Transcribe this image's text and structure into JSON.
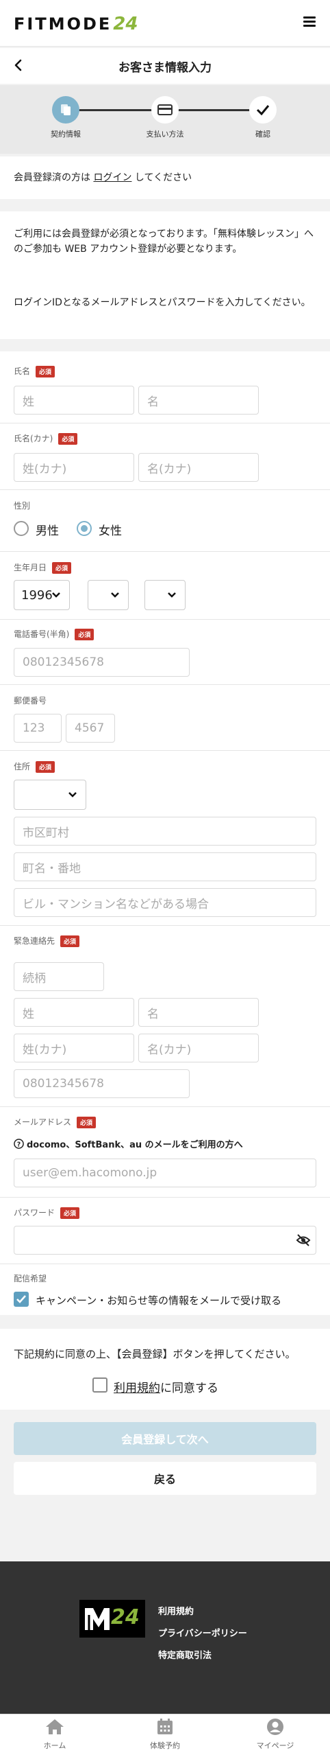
{
  "header": {
    "logo_text": "FITMODE",
    "logo_num": "24",
    "title": "お客さま情報入力"
  },
  "steps": [
    {
      "label": "契約情報",
      "icon": "document-icon",
      "active": true
    },
    {
      "label": "支払い方法",
      "icon": "card-icon",
      "active": false
    },
    {
      "label": "確認",
      "icon": "check-icon",
      "active": false
    }
  ],
  "login_notice": {
    "prefix": "会員登録済の方は",
    "link": "ログイン",
    "suffix": "してください"
  },
  "intro": {
    "p1": "ご利用には会員登録が必須となっております。「無料体験レッスン」へのご参加も WEB アカウント登録が必要となります。",
    "p2": "ログインIDとなるメールアドレスとパスワードを入力してください。"
  },
  "required_badge": "必須",
  "form": {
    "name": {
      "label": "氏名",
      "last_placeholder": "姓",
      "first_placeholder": "名"
    },
    "kana": {
      "label": "氏名(カナ)",
      "last_placeholder": "姓(カナ)",
      "first_placeholder": "名(カナ)"
    },
    "gender": {
      "label": "性別",
      "options": [
        "男性",
        "女性"
      ],
      "selected": "女性"
    },
    "birth": {
      "label": "生年月日",
      "year": "1996",
      "month": "",
      "day": ""
    },
    "phone": {
      "label": "電話番号(半角)",
      "placeholder": "08012345678"
    },
    "postal": {
      "label": "郵便番号",
      "placeholder1": "123",
      "placeholder2": "4567"
    },
    "address": {
      "label": "住所",
      "prefecture": "",
      "city_placeholder": "市区町村",
      "street_placeholder": "町名・番地",
      "building_placeholder": "ビル・マンション名などがある場合"
    },
    "emergency": {
      "label": "緊急連絡先",
      "relation_placeholder": "続柄",
      "last_placeholder": "姓",
      "first_placeholder": "名",
      "last_kana_placeholder": "姓(カナ)",
      "first_kana_placeholder": "名(カナ)",
      "phone_placeholder": "08012345678"
    },
    "email": {
      "label": "メールアドレス",
      "carrier_notice": "docomo、SoftBank、au のメールをご利用の方へ",
      "placeholder": "user@em.hacomono.jp"
    },
    "password": {
      "label": "パスワード",
      "value": ""
    },
    "newsletter": {
      "label": "配信希望",
      "checkbox_label": "キャンペーン・お知らせ等の情報をメールで受け取る",
      "checked": true
    }
  },
  "terms": {
    "notice": "下記規約に同意の上、【会員登録】ボタンを押してください。",
    "link": "利用規約",
    "suffix": "に同意する",
    "checked": false
  },
  "buttons": {
    "submit": "会員登録して次へ",
    "back": "戻る"
  },
  "footer": {
    "logo_num": "24",
    "links": [
      "利用規約",
      "プライバシーポリシー",
      "特定商取引法"
    ]
  },
  "tabbar": [
    {
      "label": "ホーム",
      "icon": "home-icon"
    },
    {
      "label": "体験予約",
      "icon": "calendar-icon"
    },
    {
      "label": "マイページ",
      "icon": "user-icon"
    }
  ],
  "colors": {
    "accent": "#7fb3cc",
    "required": "#c8362b",
    "logo_green": "#8cb63c",
    "footer_bg": "#333333"
  }
}
